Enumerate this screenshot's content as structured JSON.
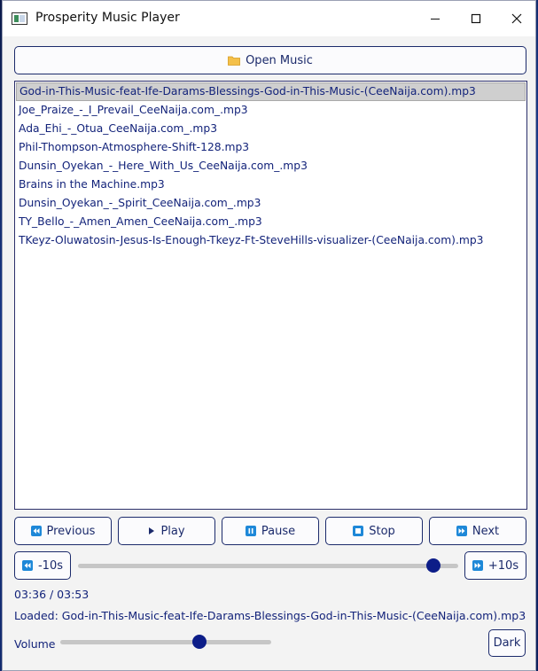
{
  "window": {
    "title": "Prosperity Music Player"
  },
  "open_button": {
    "label": "Open Music",
    "icon": "folder-icon"
  },
  "playlist": {
    "items": [
      "God-in-This-Music-feat-Ife-Darams-Blessings-God-in-This-Music-(CeeNaija.com).mp3",
      "Joe_Praize_-_I_Prevail_CeeNaija.com_.mp3",
      "Ada_Ehi_-_Otua_CeeNaija.com_.mp3",
      "Phil-Thompson-Atmosphere-Shift-128.mp3",
      "Dunsin_Oyekan_-_Here_With_Us_CeeNaija.com_.mp3",
      "Brains in the Machine.mp3",
      "Dunsin_Oyekan_-_Spirit_CeeNaija.com_.mp3",
      "TY_Bello_-_Amen_Amen_CeeNaija.com_.mp3",
      "TKeyz-Oluwatosin-Jesus-Is-Enough-Tkeyz-Ft-SteveHills-visualizer-(CeeNaija.com).mp3"
    ],
    "selected_index": 0
  },
  "controls": {
    "previous": "Previous",
    "play": "Play",
    "pause": "Pause",
    "stop": "Stop",
    "next": "Next"
  },
  "seek": {
    "back_label": "-10s",
    "forward_label": "+10s",
    "position_fraction": 0.935
  },
  "status": {
    "time": "03:36 / 03:53",
    "loaded": "Loaded: God-in-This-Music-feat-Ife-Darams-Blessings-God-in-This-Music-(CeeNaija.com).mp3"
  },
  "volume": {
    "label": "Volume",
    "level_fraction": 0.66
  },
  "theme_button": {
    "label": "Dark"
  },
  "colors": {
    "accent": "#1b2a6b",
    "icon_blue": "#1e88d8",
    "slider_handle": "#0c1d88"
  }
}
